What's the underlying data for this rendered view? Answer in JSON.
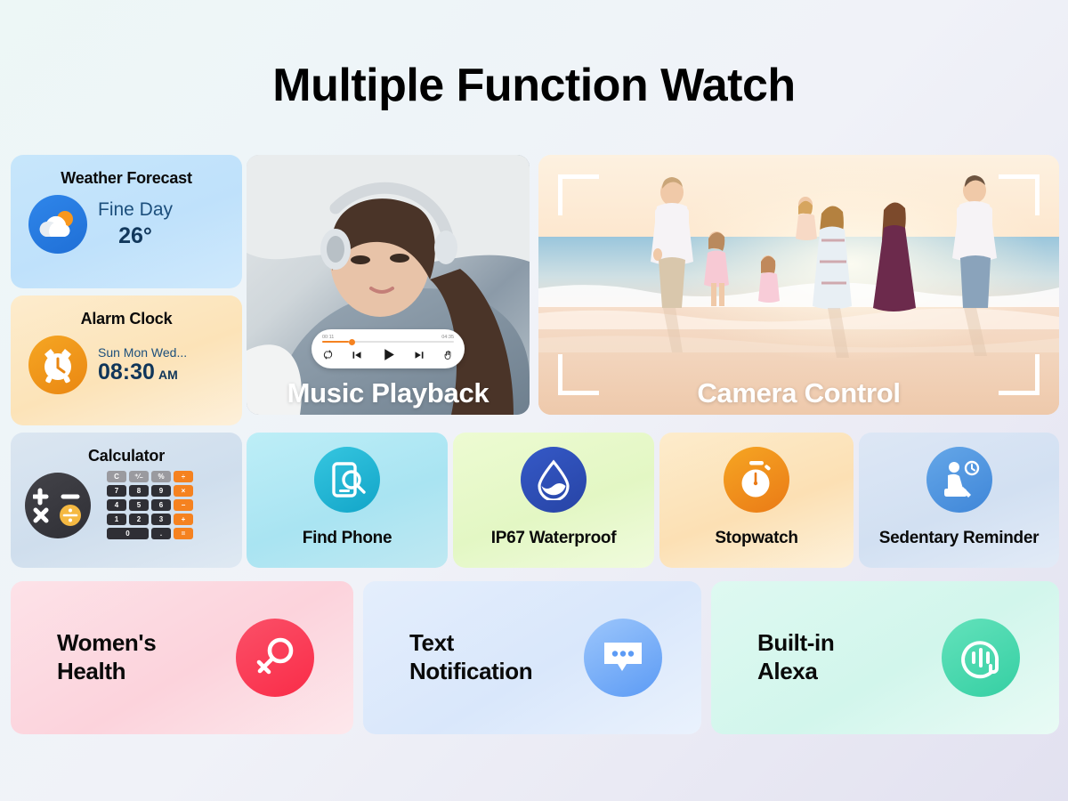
{
  "page": {
    "title": "Multiple Function Watch",
    "background_from": "#edf7f6",
    "background_to": "#e2e1f0"
  },
  "weather": {
    "title": "Weather Forecast",
    "condition": "Fine Day",
    "temperature": "26°",
    "icon": "sun-cloud-icon",
    "card_color": "#c7e6fb",
    "badge_color": "#2f86ea"
  },
  "alarm": {
    "title": "Alarm Clock",
    "days": "Sun Mon Wed...",
    "time": "08:30",
    "meridiem": "AM",
    "icon": "alarm-clock-icon",
    "card_color": "#fdeccd",
    "badge_color": "#f5a623"
  },
  "calculator": {
    "title": "Calculator",
    "badge_symbols": [
      "+",
      "−",
      "×",
      "÷"
    ],
    "keypad": [
      {
        "label": "C",
        "style": "grey"
      },
      {
        "label": "⁺⁄₋",
        "style": "grey"
      },
      {
        "label": "%",
        "style": "grey"
      },
      {
        "label": "÷",
        "style": "orange"
      },
      {
        "label": "7",
        "style": "dark"
      },
      {
        "label": "8",
        "style": "dark"
      },
      {
        "label": "9",
        "style": "dark"
      },
      {
        "label": "×",
        "style": "orange"
      },
      {
        "label": "4",
        "style": "dark"
      },
      {
        "label": "5",
        "style": "dark"
      },
      {
        "label": "6",
        "style": "dark"
      },
      {
        "label": "−",
        "style": "orange"
      },
      {
        "label": "1",
        "style": "dark"
      },
      {
        "label": "2",
        "style": "dark"
      },
      {
        "label": "3",
        "style": "dark"
      },
      {
        "label": "+",
        "style": "orange"
      },
      {
        "label": "0",
        "style": "dark wide"
      },
      {
        "label": ".",
        "style": "dark"
      },
      {
        "label": "=",
        "style": "orange"
      }
    ],
    "card_color": "#dbe6f1"
  },
  "music": {
    "label": "Music Playback",
    "elapsed": "00:11",
    "duration": "04:35",
    "progress_percent": 20,
    "progress_color": "#f58220",
    "controls": [
      "repeat-icon",
      "previous-track-icon",
      "play-icon",
      "next-track-icon",
      "gesture-hand-icon"
    ],
    "photo_alt": "woman-with-headphones-photo"
  },
  "camera": {
    "label": "Camera Control",
    "viewfinder": "corner-brackets",
    "photo_alt": "family-on-beach-at-sunset-photo"
  },
  "features": [
    {
      "label": "Find Phone",
      "icon": "find-phone-icon",
      "card_color": "#bdeef7",
      "badge_color": "#36c6e0"
    },
    {
      "label": "IP67 Waterproof",
      "icon": "water-drop-icon",
      "card_color": "#edfbd2",
      "badge_color": "#3559c7"
    },
    {
      "label": "Stopwatch",
      "icon": "stopwatch-icon",
      "card_color": "#fdeccc",
      "badge_color": "#f6a623"
    },
    {
      "label": "Sedentary Reminder",
      "icon": "sitting-person-clock-icon",
      "card_color": "#dde7f5",
      "badge_color": "#65a7e8"
    }
  ],
  "wide_features": [
    {
      "line1": "Women's",
      "line2": "Health",
      "icon": "female-symbol-icon",
      "card_color": "#fde2e8",
      "badge_color": "#fb5068"
    },
    {
      "line1": "Text",
      "line2": "Notification",
      "icon": "speech-bubble-icon",
      "card_color": "#e4eefc",
      "badge_color": "#5c9bf5"
    },
    {
      "line1": "Built-in",
      "line2": "Alexa",
      "icon": "alexa-voice-icon",
      "card_color": "#def9f1",
      "badge_color": "#35cfa3"
    }
  ]
}
